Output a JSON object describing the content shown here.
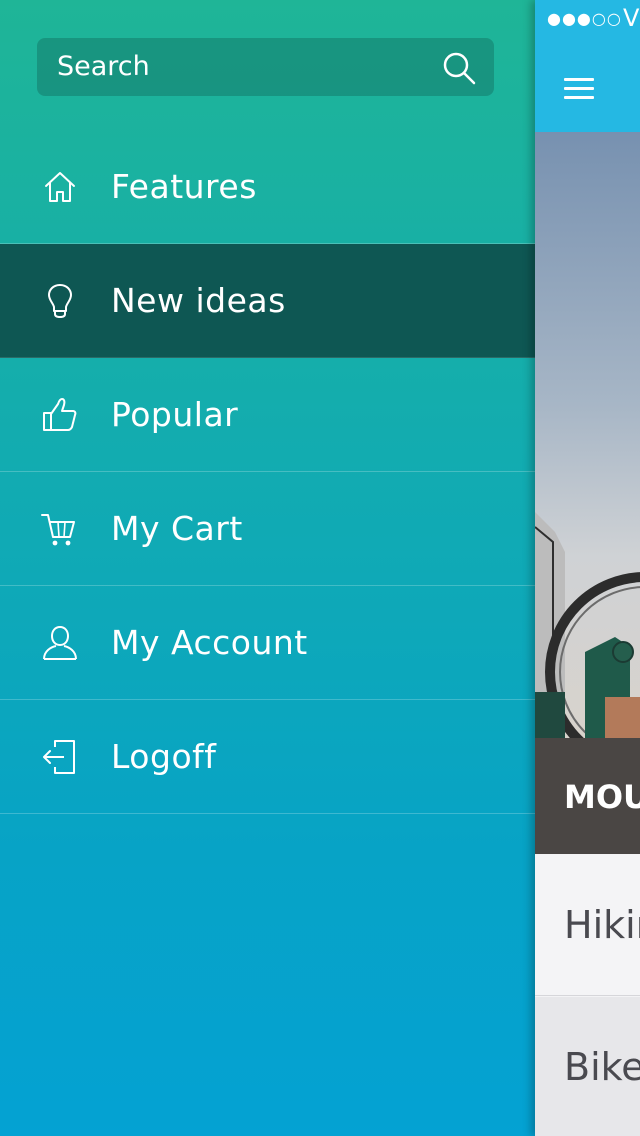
{
  "search": {
    "placeholder": "Search"
  },
  "menu": {
    "items": [
      {
        "label": "Features",
        "icon": "home-icon",
        "active": false
      },
      {
        "label": "New ideas",
        "icon": "lightbulb-icon",
        "active": true
      },
      {
        "label": "Popular",
        "icon": "thumbs-up-icon",
        "active": false
      },
      {
        "label": "My Cart",
        "icon": "cart-icon",
        "active": false
      },
      {
        "label": "My Account",
        "icon": "user-icon",
        "active": false
      },
      {
        "label": "Logoff",
        "icon": "logout-icon",
        "active": false
      }
    ]
  },
  "status_bar": {
    "signal": "●●●○○",
    "carrier": "V"
  },
  "main": {
    "caption": "MOU",
    "rows": [
      "Hikir",
      "Bike"
    ]
  },
  "colors": {
    "menu_gradient_top": "#1fb597",
    "menu_gradient_bottom": "#04a2d3",
    "active_item": "#0e5753",
    "navbar": "#25b8e3"
  }
}
